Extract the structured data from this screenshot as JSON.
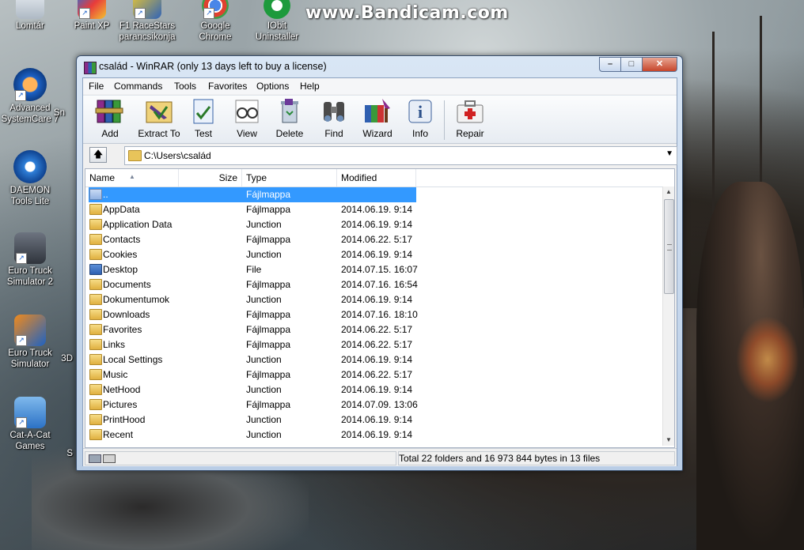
{
  "watermark": "www.Bandicam.com",
  "desktop": {
    "icons": [
      {
        "name": "recycle-bin-icon",
        "label": "Lomtár"
      },
      {
        "name": "paint-xp-icon",
        "label": "Paint XP"
      },
      {
        "name": "f1-racestars-icon",
        "label": "F1 RaceStars parancsikonja"
      },
      {
        "name": "google-chrome-icon",
        "label": "Google Chrome"
      },
      {
        "name": "iobit-uninstaller-icon",
        "label": "IObit Uninstaller"
      },
      {
        "name": "advanced-systemcare-icon",
        "label": "Advanced SystemCare 7"
      },
      {
        "name": "daemon-tools-icon",
        "label": "DAEMON Tools Lite"
      },
      {
        "name": "euro-truck-2-icon",
        "label": "Euro Truck Simulator 2"
      },
      {
        "name": "euro-truck-icon",
        "label": "Euro Truck Simulator"
      },
      {
        "name": "cat-a-cat-icon",
        "label": "Cat-A-Cat Games"
      }
    ],
    "partial_labels": [
      "Sn",
      "3D",
      "S"
    ]
  },
  "window": {
    "title": "család - WinRAR (only 13 days left to buy a license)",
    "caption_buttons": {
      "minimize": "–",
      "maximize": "□",
      "close": "✕"
    },
    "menu": [
      "File",
      "Commands",
      "Tools",
      "Favorites",
      "Options",
      "Help"
    ],
    "toolbar": [
      {
        "name": "add-button",
        "label": "Add"
      },
      {
        "name": "extract-to-button",
        "label": "Extract To"
      },
      {
        "name": "test-button",
        "label": "Test"
      },
      {
        "name": "view-button",
        "label": "View"
      },
      {
        "name": "delete-button",
        "label": "Delete"
      },
      {
        "name": "find-button",
        "label": "Find"
      },
      {
        "name": "wizard-button",
        "label": "Wizard"
      },
      {
        "name": "info-button",
        "label": "Info"
      },
      {
        "name": "repair-button",
        "label": "Repair"
      }
    ],
    "address": "C:\\Users\\család",
    "columns": {
      "name": "Name",
      "size": "Size",
      "type": "Type",
      "modified": "Modified"
    },
    "files": [
      {
        "name": "..",
        "size": "",
        "type": "Fájlmappa",
        "modified": "",
        "icon": "up",
        "selected": true
      },
      {
        "name": "AppData",
        "size": "",
        "type": "Fájlmappa",
        "modified": "2014.06.19. 9:14",
        "icon": "folder"
      },
      {
        "name": "Application Data",
        "size": "",
        "type": "Junction",
        "modified": "2014.06.19. 9:14",
        "icon": "junction"
      },
      {
        "name": "Contacts",
        "size": "",
        "type": "Fájlmappa",
        "modified": "2014.06.22. 5:17",
        "icon": "folder"
      },
      {
        "name": "Cookies",
        "size": "",
        "type": "Junction",
        "modified": "2014.06.19. 9:14",
        "icon": "junction"
      },
      {
        "name": "Desktop",
        "size": "",
        "type": "File",
        "modified": "2014.07.15. 16:07",
        "icon": "file"
      },
      {
        "name": "Documents",
        "size": "",
        "type": "Fájlmappa",
        "modified": "2014.07.16. 16:54",
        "icon": "folder"
      },
      {
        "name": "Dokumentumok",
        "size": "",
        "type": "Junction",
        "modified": "2014.06.19. 9:14",
        "icon": "junction"
      },
      {
        "name": "Downloads",
        "size": "",
        "type": "Fájlmappa",
        "modified": "2014.07.16. 18:10",
        "icon": "folder"
      },
      {
        "name": "Favorites",
        "size": "",
        "type": "Fájlmappa",
        "modified": "2014.06.22. 5:17",
        "icon": "folder"
      },
      {
        "name": "Links",
        "size": "",
        "type": "Fájlmappa",
        "modified": "2014.06.22. 5:17",
        "icon": "folder"
      },
      {
        "name": "Local Settings",
        "size": "",
        "type": "Junction",
        "modified": "2014.06.19. 9:14",
        "icon": "junction"
      },
      {
        "name": "Music",
        "size": "",
        "type": "Fájlmappa",
        "modified": "2014.06.22. 5:17",
        "icon": "folder"
      },
      {
        "name": "NetHood",
        "size": "",
        "type": "Junction",
        "modified": "2014.06.19. 9:14",
        "icon": "junction"
      },
      {
        "name": "Pictures",
        "size": "",
        "type": "Fájlmappa",
        "modified": "2014.07.09. 13:06",
        "icon": "folder"
      },
      {
        "name": "PrintHood",
        "size": "",
        "type": "Junction",
        "modified": "2014.06.19. 9:14",
        "icon": "junction"
      },
      {
        "name": "Recent",
        "size": "",
        "type": "Junction",
        "modified": "2014.06.19. 9:14",
        "icon": "junction"
      }
    ],
    "status": "Total 22 folders and 16 973 844 bytes in 13 files"
  },
  "colors": {
    "selection": "#3399ff",
    "close_button": "#c6452b",
    "title_bar": "#d9e6f5"
  }
}
